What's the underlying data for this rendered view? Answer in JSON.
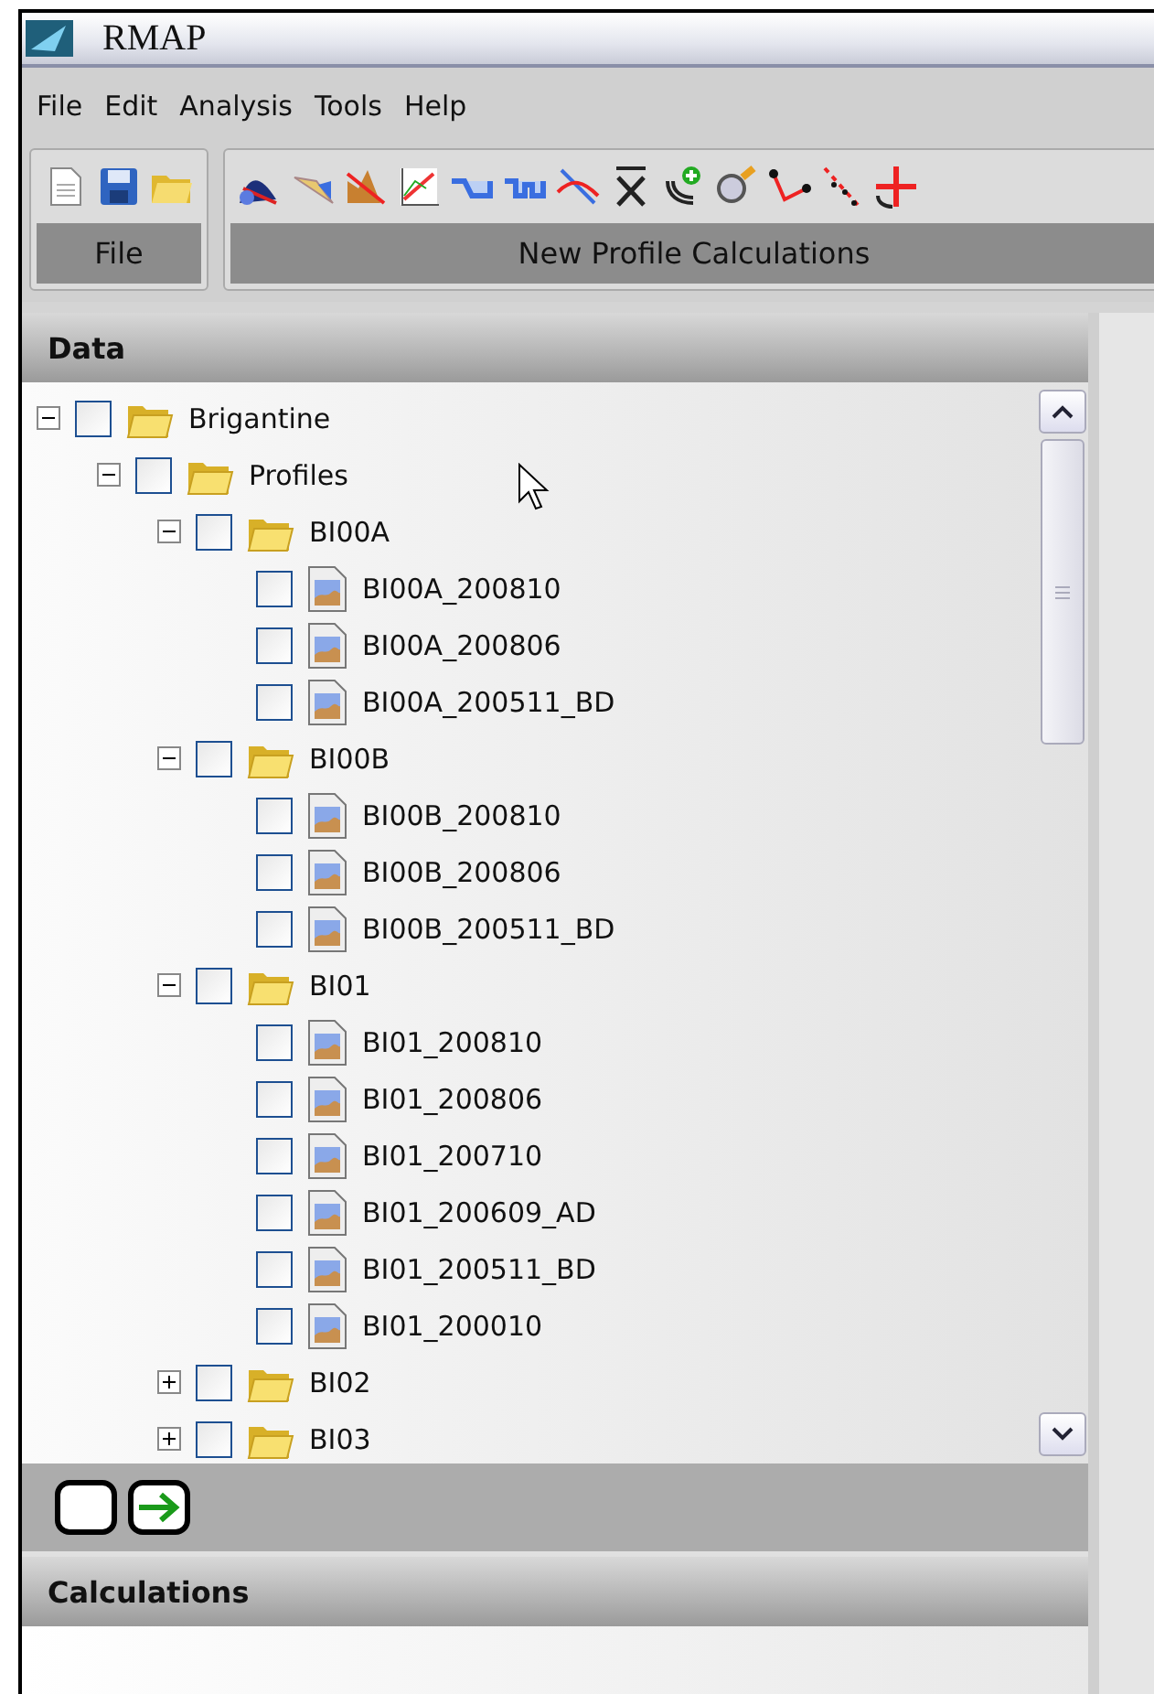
{
  "window": {
    "title": "RMAP"
  },
  "menu": [
    "File",
    "Edit",
    "Analysis",
    "Tools",
    "Help"
  ],
  "toolbar_groups": [
    {
      "kind": "file",
      "label": "File"
    },
    {
      "kind": "calculations",
      "label": "New Profile Calculations"
    }
  ],
  "data_panel": {
    "title": "Data",
    "tree": [
      {
        "label": "Brigantine",
        "kind": "folder",
        "checked": false,
        "expanded": true,
        "children": [
          {
            "label": "Profiles",
            "kind": "folder",
            "checked": false,
            "expanded": true,
            "children": [
              {
                "label": "BI00A",
                "kind": "folder",
                "checked": false,
                "expanded": true,
                "children": [
                  {
                    "label": "BI00A_200810",
                    "kind": "profile",
                    "checked": false
                  },
                  {
                    "label": "BI00A_200806",
                    "kind": "profile",
                    "checked": false
                  },
                  {
                    "label": "BI00A_200511_BD",
                    "kind": "profile",
                    "checked": false
                  }
                ]
              },
              {
                "label": "BI00B",
                "kind": "folder",
                "checked": false,
                "expanded": true,
                "children": [
                  {
                    "label": "BI00B_200810",
                    "kind": "profile",
                    "checked": false
                  },
                  {
                    "label": "BI00B_200806",
                    "kind": "profile",
                    "checked": false
                  },
                  {
                    "label": "BI00B_200511_BD",
                    "kind": "profile",
                    "checked": false
                  }
                ]
              },
              {
                "label": "BI01",
                "kind": "folder",
                "checked": false,
                "expanded": true,
                "children": [
                  {
                    "label": "BI01_200810",
                    "kind": "profile",
                    "checked": false
                  },
                  {
                    "label": "BI01_200806",
                    "kind": "profile",
                    "checked": false
                  },
                  {
                    "label": "BI01_200710",
                    "kind": "profile",
                    "checked": false
                  },
                  {
                    "label": "BI01_200609_AD",
                    "kind": "profile",
                    "checked": false
                  },
                  {
                    "label": "BI01_200511_BD",
                    "kind": "profile",
                    "checked": false
                  },
                  {
                    "label": "BI01_200010",
                    "kind": "profile",
                    "checked": false
                  }
                ]
              },
              {
                "label": "BI02",
                "kind": "folder",
                "checked": false,
                "expanded": false
              },
              {
                "label": "BI03",
                "kind": "folder",
                "checked": false,
                "expanded": false
              }
            ]
          }
        ]
      }
    ]
  },
  "calculations_panel": {
    "title": "Calculations"
  }
}
